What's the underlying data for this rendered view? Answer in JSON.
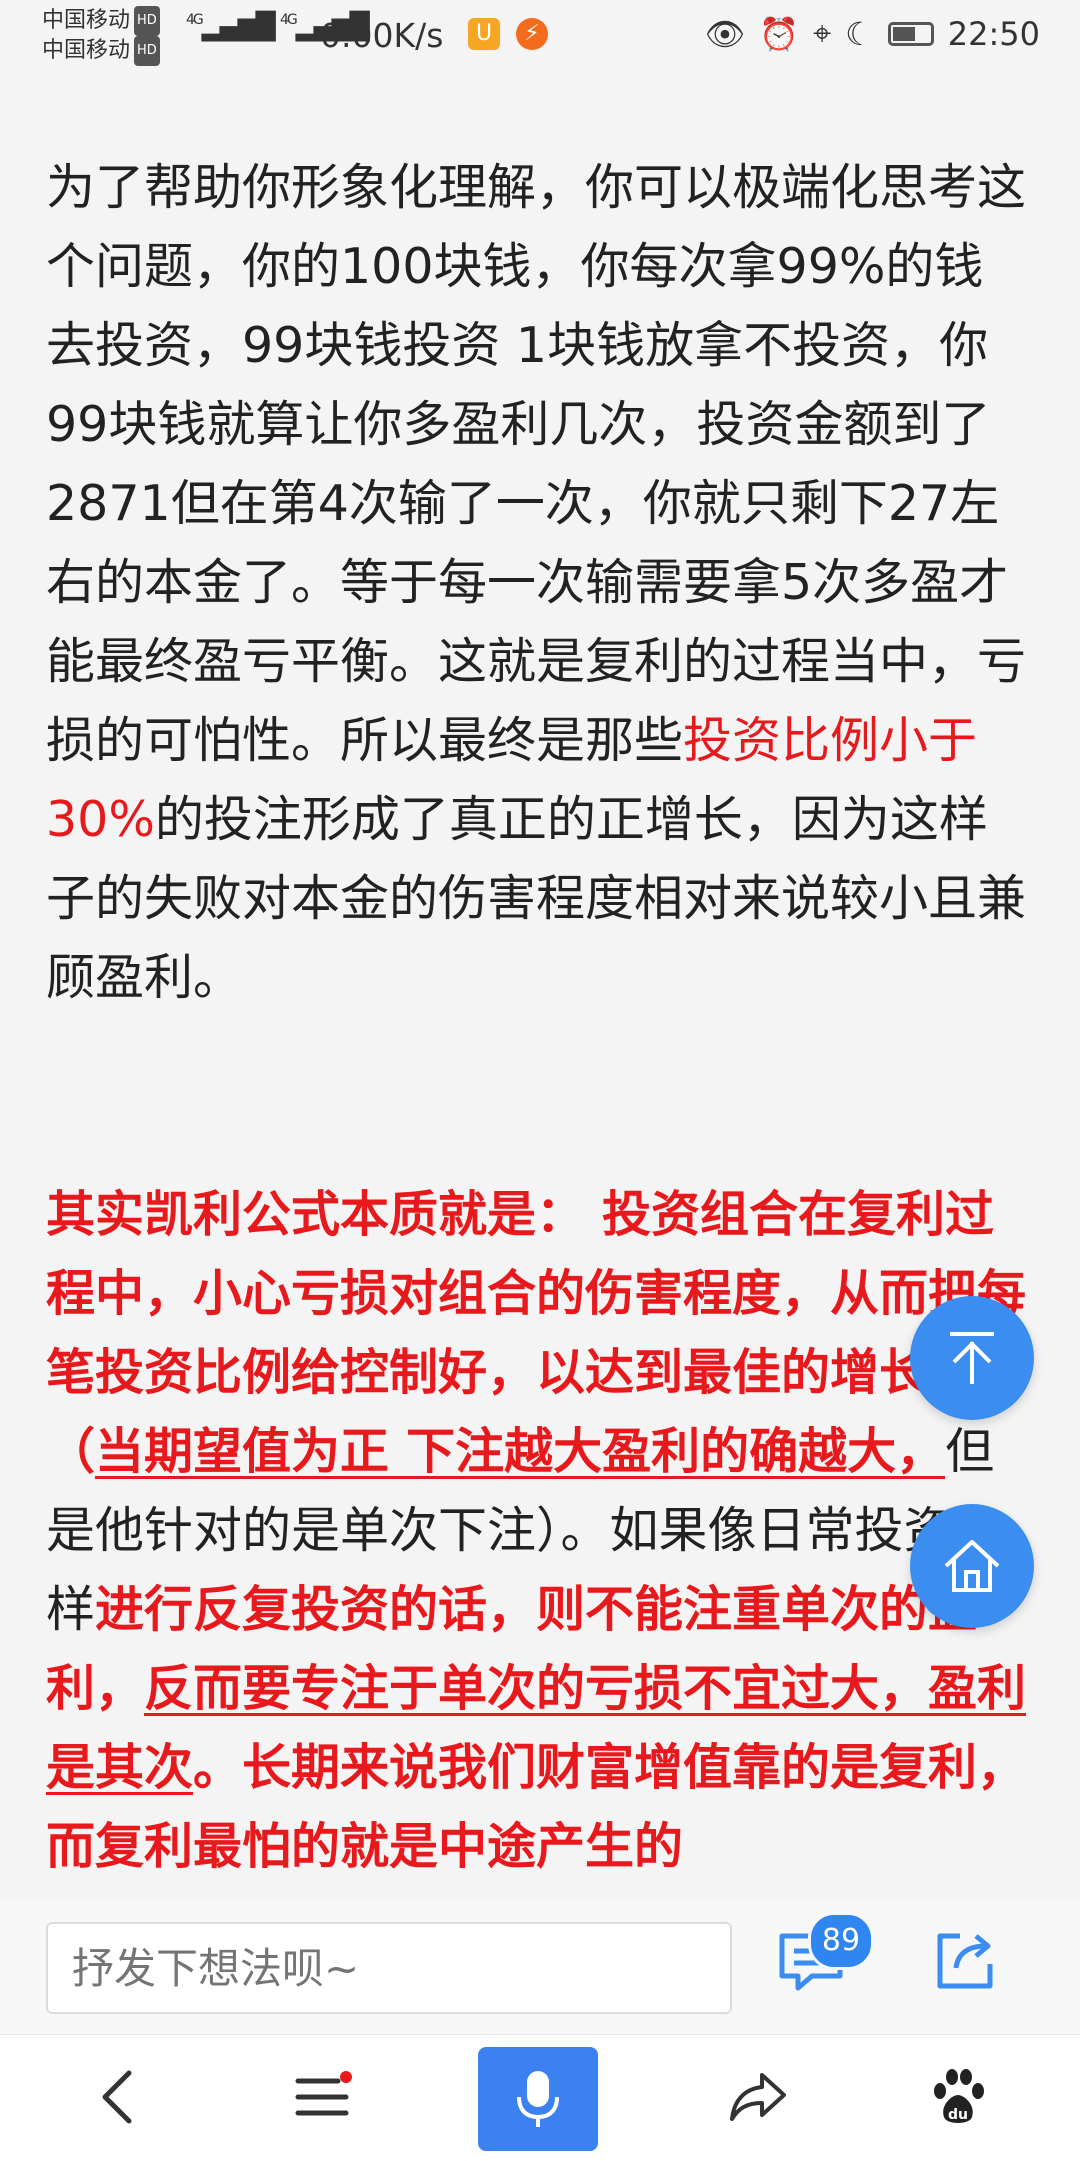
{
  "status_bar": {
    "carrier1": "中国移动",
    "carrier2": "中国移动",
    "hd_label": "HD",
    "network1": "4G",
    "network2": "4G",
    "speed": "0.00K/s",
    "time": "22:50",
    "icons": [
      "eye-icon",
      "alarm-icon",
      "location-icon",
      "moon-icon",
      "battery-icon"
    ]
  },
  "article": {
    "para1": {
      "part1": "为了帮助你形象化理解，你可以极端化思考这个问题，你的100块钱，你每次拿99%的钱去投资，99块钱投资 1块钱放拿不投资，你99块钱就算让你多盈利几次，投资金额到了2871但在第4次输了一次，你就只剩下27左右的本金了。等于每一次输需要拿5次多盈才能最终盈亏平衡。这就是复利的过程当中，亏损的可怕性。所以最终是那些",
      "red": "投资比例小于30%",
      "part2": "的投注形成了真正的正增长，因为这样子的失败对本金的伤害程度相对来说较小且兼顾盈利。"
    },
    "para2": {
      "bold1": "其实凯利公式本质就是： 投资组合在复利过程中，小心亏损对组合的伤害程度，从而把每笔投资比例给控制好，以达到最佳的增长比例（",
      "bold_ul1": "当期望值为正 下注越大盈利的确越大，",
      "normal1": "但是他针对的是单次下注）。如果像日常投资一样",
      "bold2": "进行反复投资的话，则不能注重单次的盈利，",
      "bold_ul2": "反而要专注于单次的亏损不宜过大，盈利是其次",
      "bold3": "。长期来说我们财富增值靠的是复利，而复利最怕的就是中途产生的"
    }
  },
  "floating_buttons": [
    "back-to-top-icon",
    "home-icon"
  ],
  "comment_bar": {
    "placeholder": "抒发下想法呗~",
    "comment_count": "89"
  },
  "nav_bar": {
    "items": [
      "back-icon",
      "menu-icon",
      "mic-icon",
      "share-icon",
      "baidu-paw-icon"
    ]
  },
  "colors": {
    "accent_blue": "#3b8df0",
    "highlight_red": "#e8191c"
  }
}
